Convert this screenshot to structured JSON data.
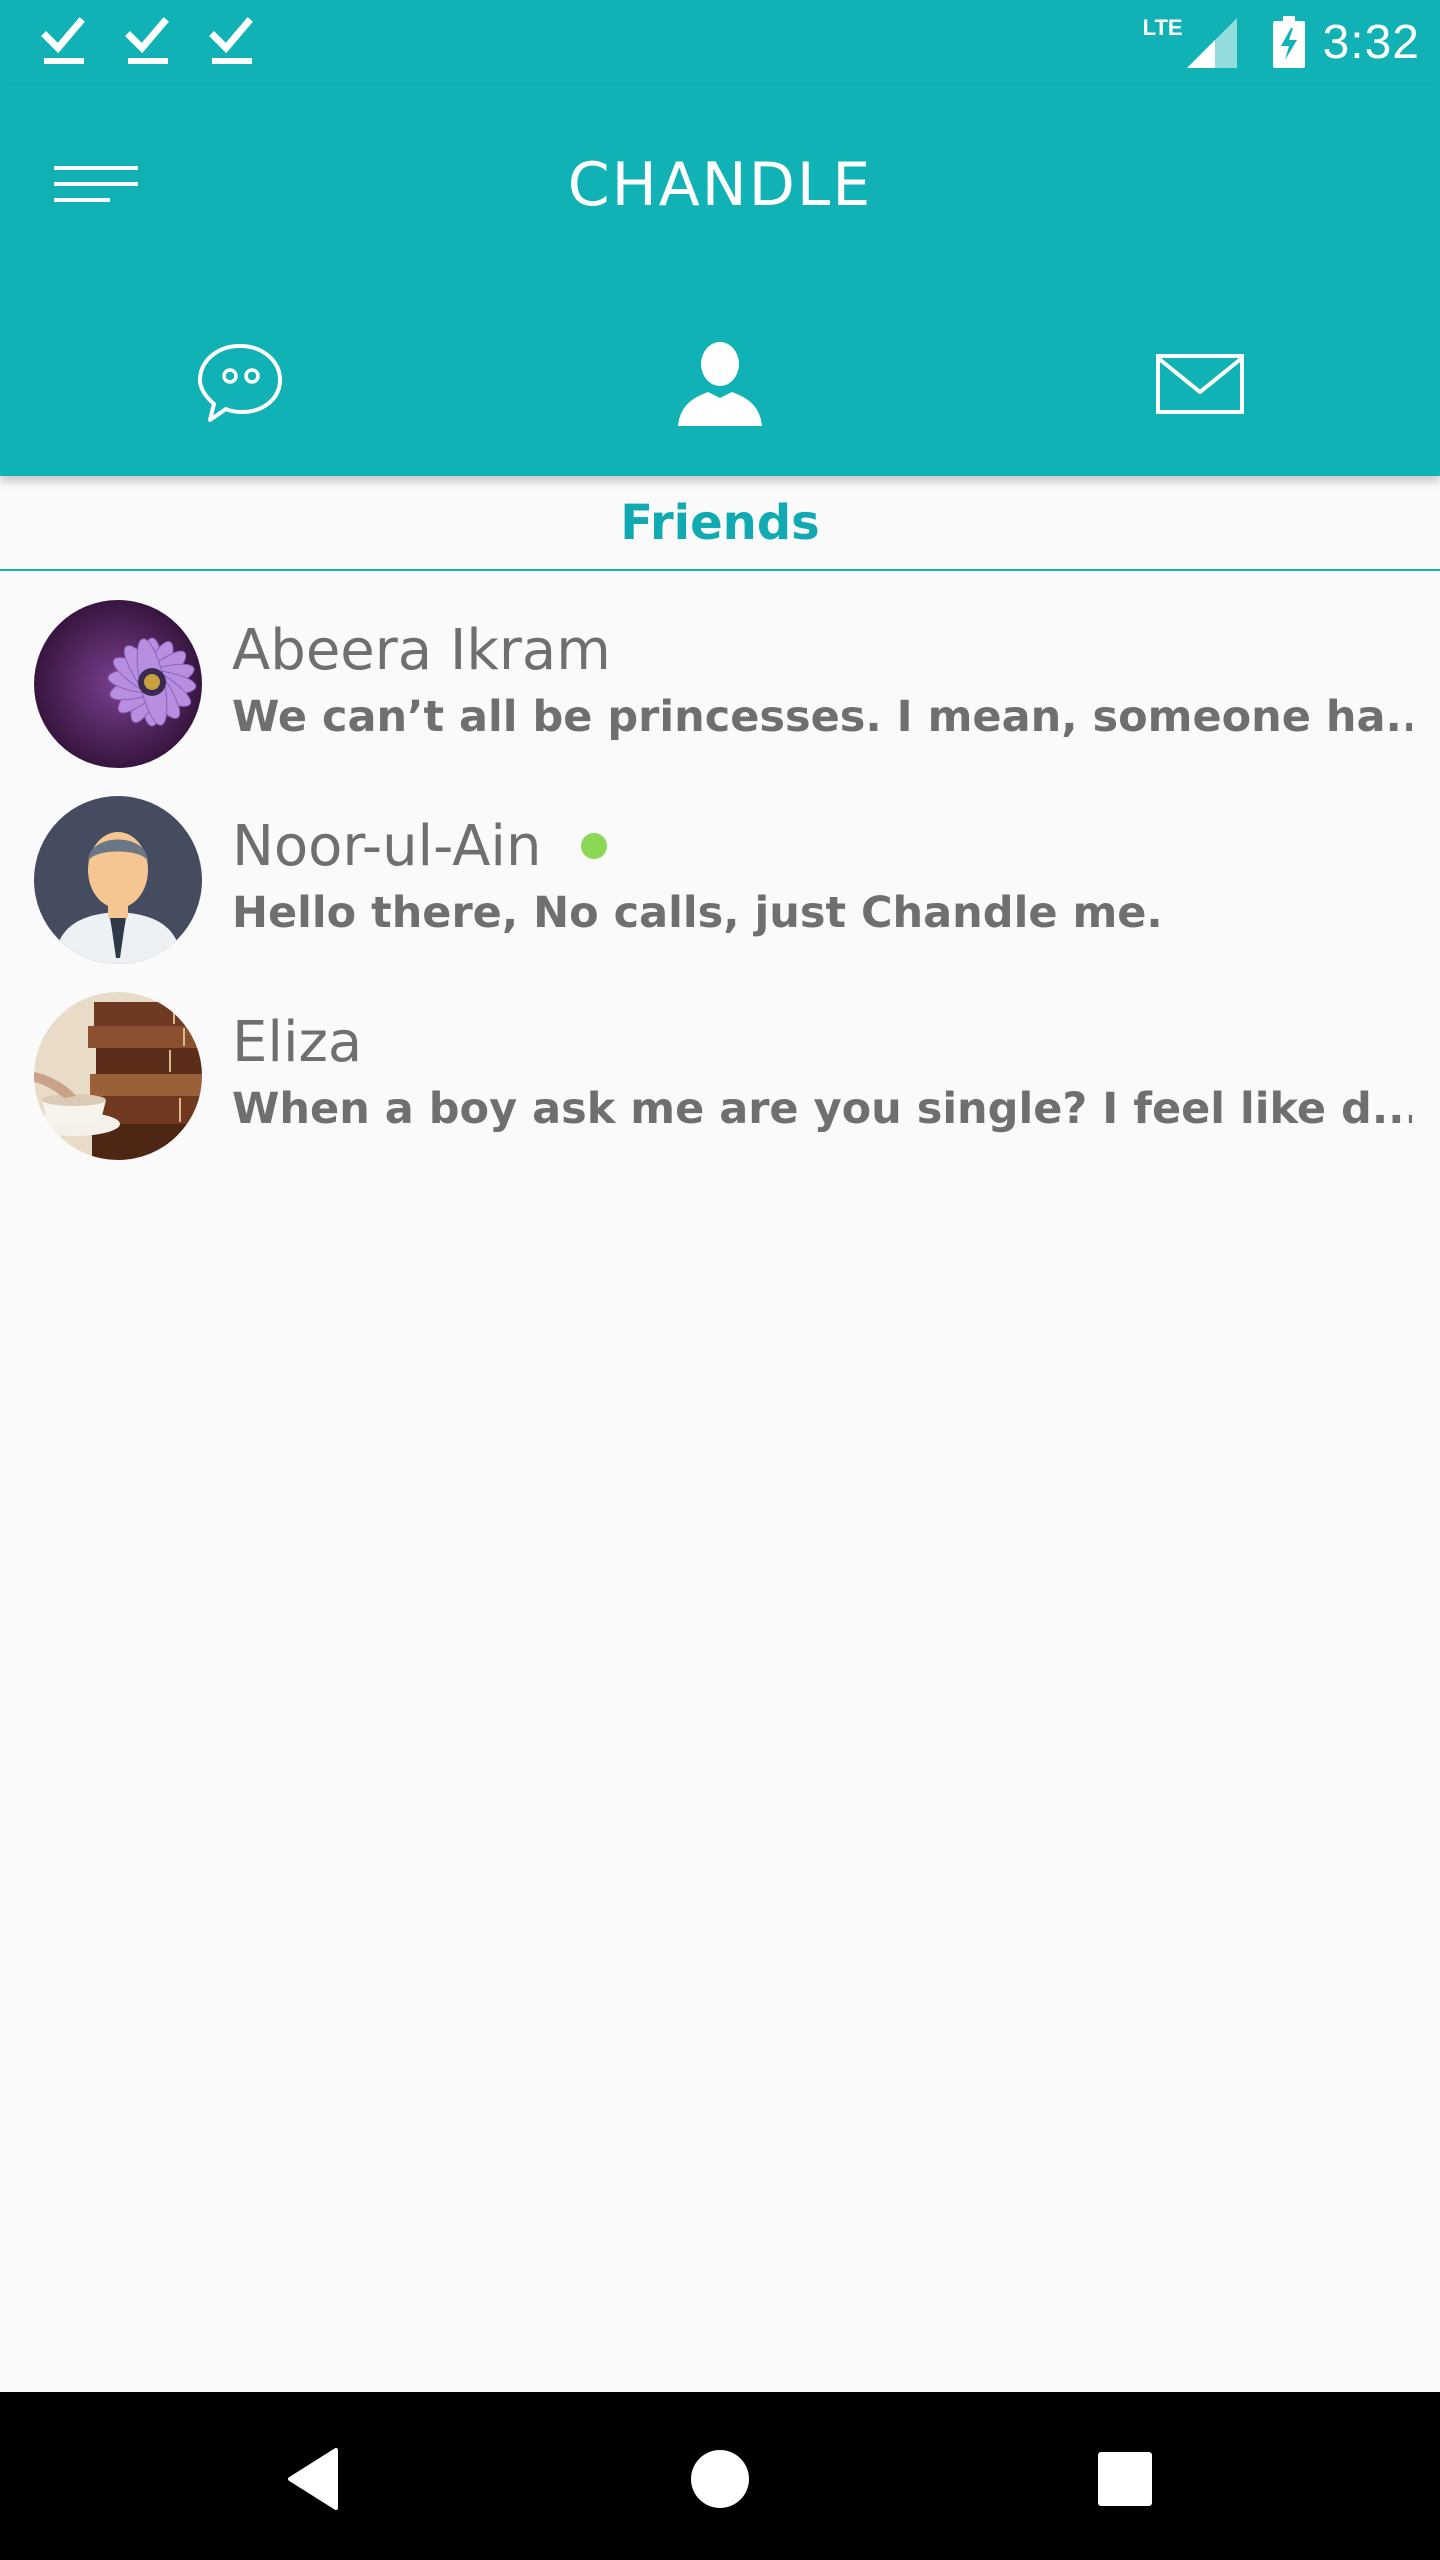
{
  "status_bar": {
    "time": "3:32",
    "network": "LTE",
    "notification_icons": [
      "check-icon",
      "check-icon",
      "check-icon"
    ],
    "battery_icon": "battery-charging-icon",
    "signal_icon": "signal-icon"
  },
  "app_bar": {
    "title": "CHANDLE",
    "menu_icon": "menu-icon",
    "tabs": [
      {
        "icon": "chat-bubble-icon",
        "active": false
      },
      {
        "icon": "person-icon",
        "active": true
      },
      {
        "icon": "envelope-icon",
        "active": false
      }
    ]
  },
  "section": {
    "label": "Friends"
  },
  "friends": [
    {
      "name": "Abeera Ikram",
      "message": "We can’t all be princesses. I mean, someone ha...",
      "online": false,
      "avatar": "purple-flower-avatar"
    },
    {
      "name": "Noor-ul-Ain",
      "message": "Hello there, No calls, just Chandle me.",
      "online": true,
      "avatar": "man-in-tie-avatar"
    },
    {
      "name": "Eliza",
      "message": "When a boy ask me are you single? I feel like d...",
      "online": false,
      "avatar": "books-teacup-avatar"
    }
  ],
  "nav_bar": {
    "buttons": [
      "back-icon",
      "home-icon",
      "recents-icon"
    ]
  },
  "colors": {
    "primary": "#11b2b5",
    "accent_text": "#11aab2",
    "online": "#8cd855",
    "text": "#6f6f6f"
  }
}
